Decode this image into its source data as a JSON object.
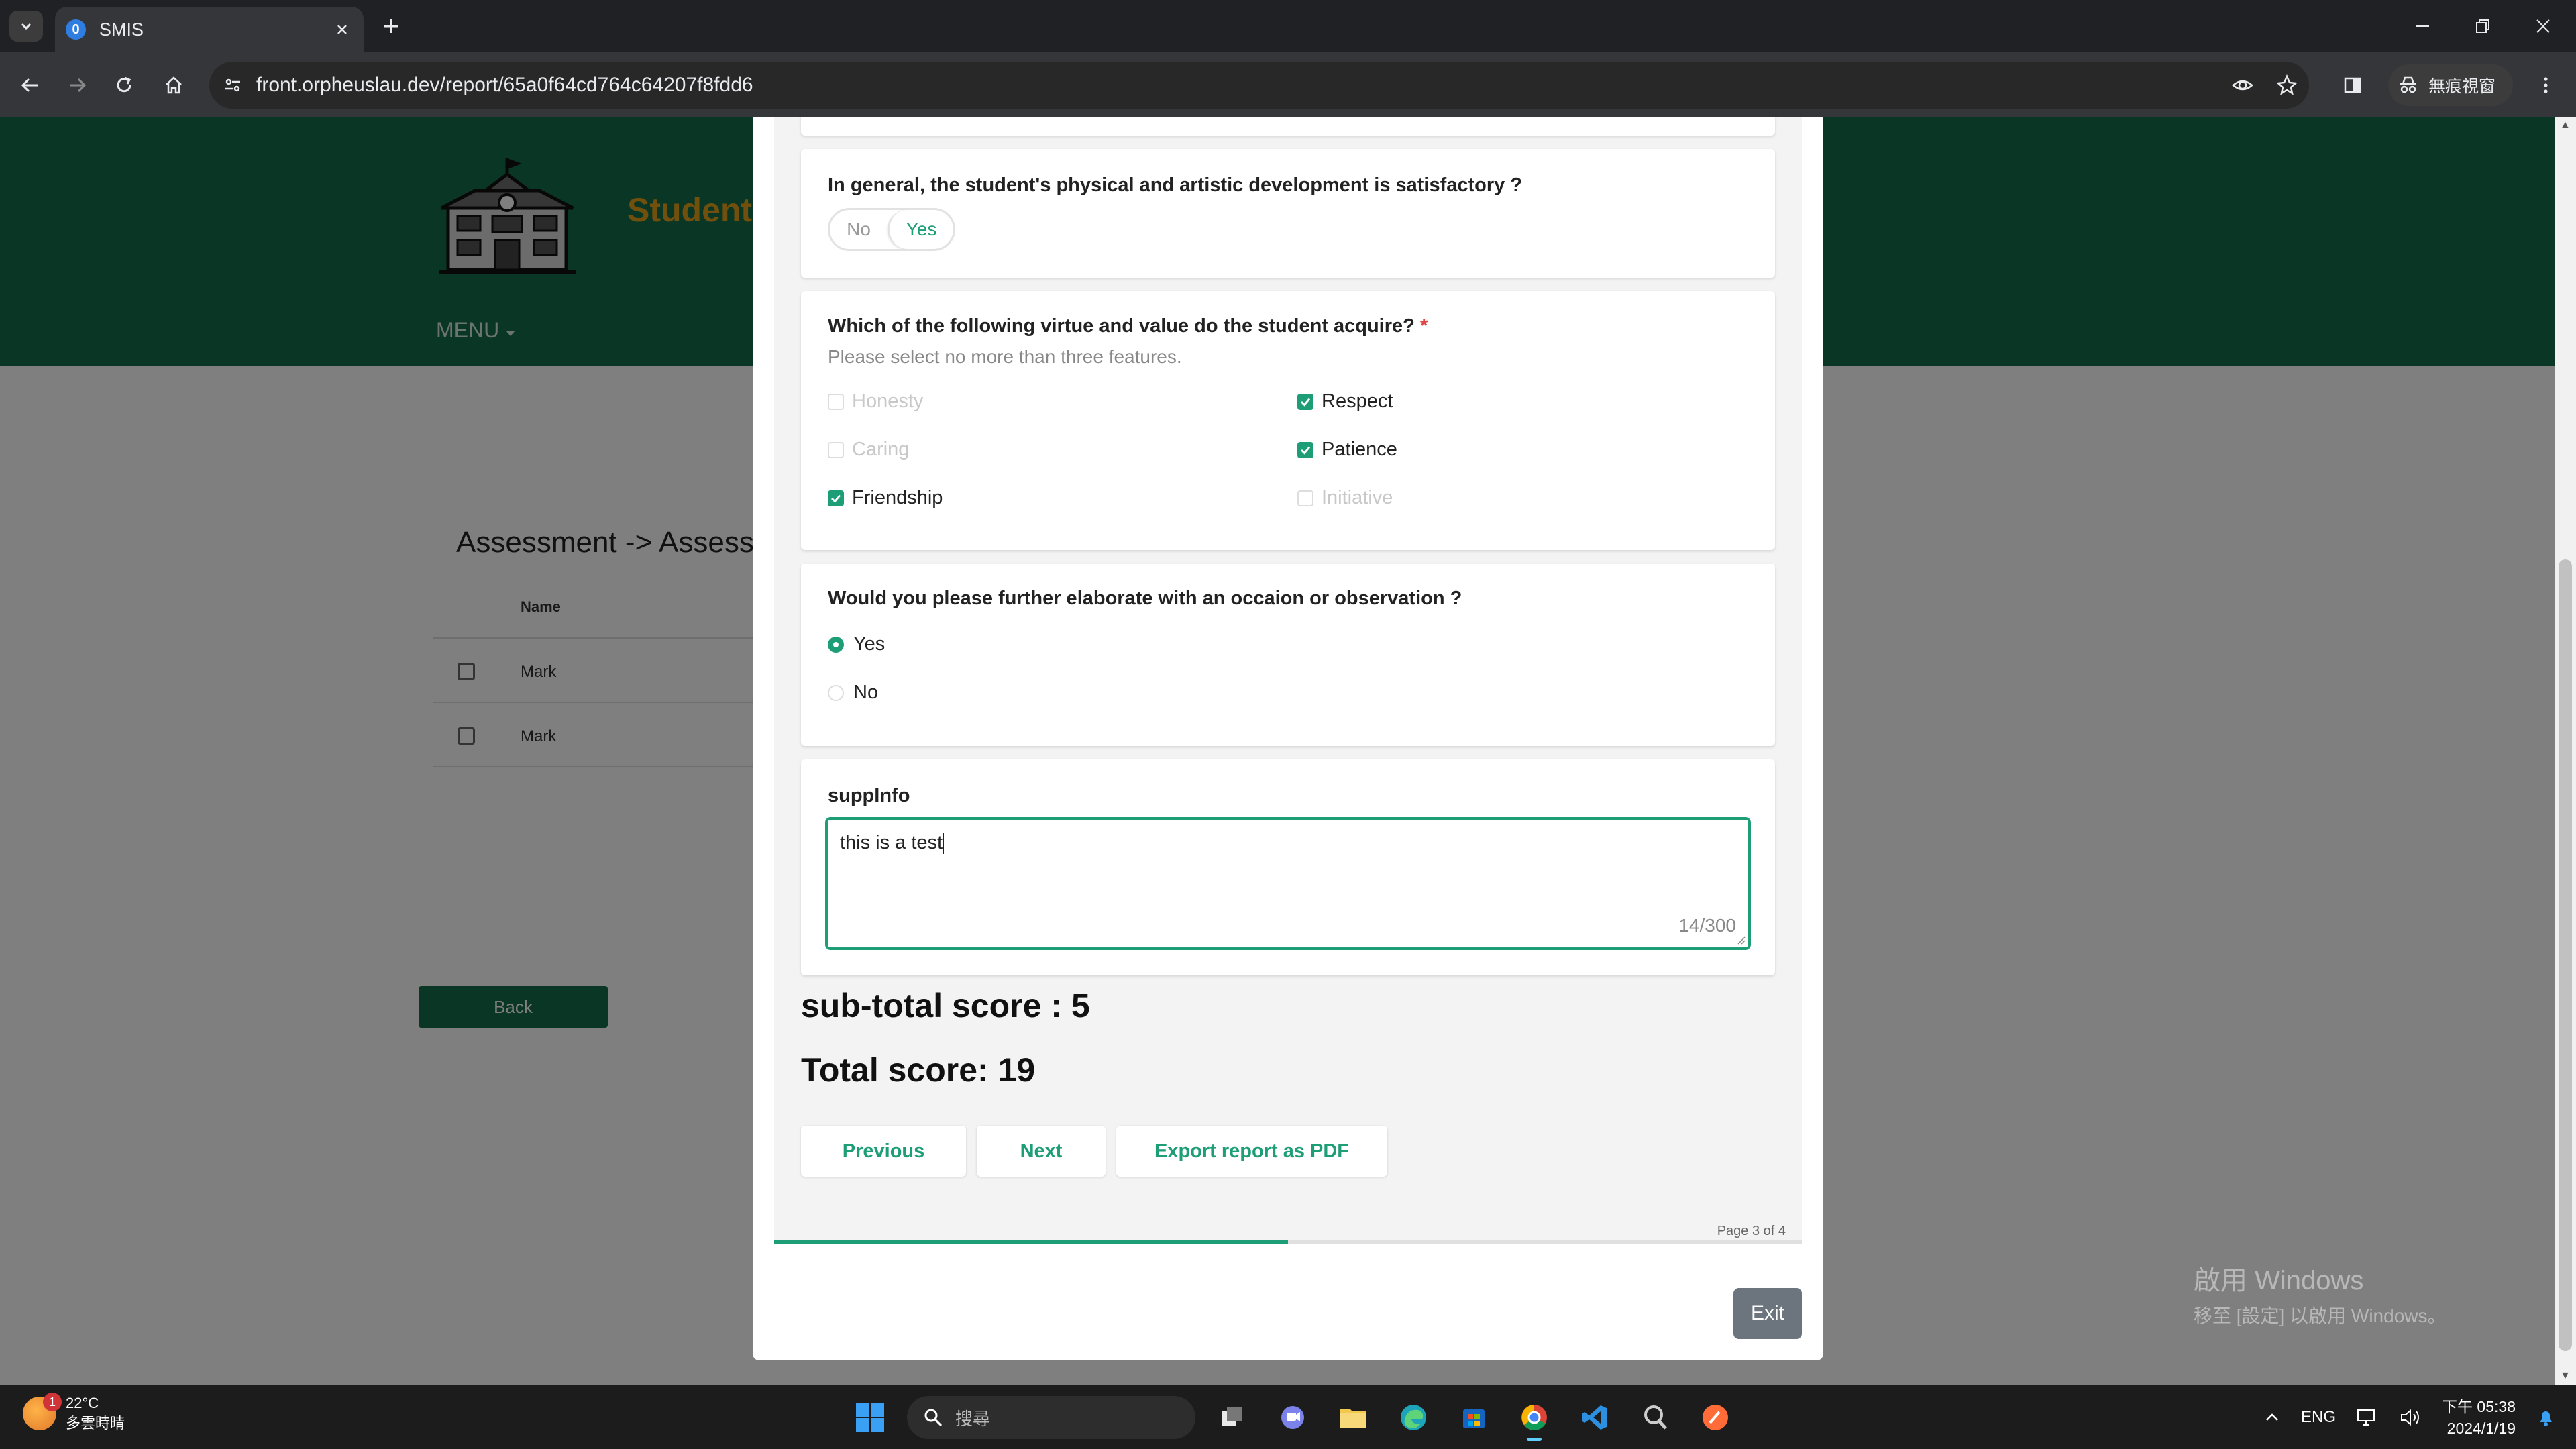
{
  "browser": {
    "tab_title": "SMIS",
    "url": "front.orpheuslau.dev/report/65a0f64cd764c64207f8fdd6",
    "profile_label": "無痕視窗"
  },
  "site": {
    "title": "Student",
    "menu_label": "MENU",
    "breadcrumb": "Assessment -> Assessm",
    "table": {
      "header_name": "Name",
      "rows": [
        "Mark",
        "Mark"
      ]
    },
    "back_label": "Back"
  },
  "form": {
    "q_physical": {
      "title": "In general, the student's physical and artistic development is satisfactory ?",
      "options": [
        "No",
        "Yes"
      ],
      "selected": "Yes"
    },
    "q_virtue": {
      "title": "Which of the following virtue and value do the student acquire?",
      "required_mark": "*",
      "description": "Please select no more than three features.",
      "options": [
        {
          "label": "Honesty",
          "checked": false
        },
        {
          "label": "Respect",
          "checked": true
        },
        {
          "label": "Caring",
          "checked": false
        },
        {
          "label": "Patience",
          "checked": true
        },
        {
          "label": "Friendship",
          "checked": true
        },
        {
          "label": "Initiative",
          "checked": false
        }
      ]
    },
    "q_elaborate": {
      "title": "Would you please further elaborate with an occaion or observation ?",
      "options": [
        "Yes",
        "No"
      ],
      "selected": "Yes"
    },
    "supp_info": {
      "label": "suppInfo",
      "value": "this is a test",
      "counter": "14/300"
    },
    "subtotal": "sub-total score : 5",
    "total": "Total score: 19",
    "buttons": {
      "previous": "Previous",
      "next": "Next",
      "export": "Export report as PDF"
    },
    "page_indicator": "Page 3 of 4",
    "progress_fraction": 0.5,
    "exit_label": "Exit"
  },
  "windows": {
    "watermark_title": "啟用 Windows",
    "watermark_sub": "移至 [設定] 以啟用 Windows。",
    "weather_temp": "22°C",
    "weather_desc": "多雲時晴",
    "weather_badge": "1",
    "search_placeholder": "搜尋",
    "lang": "ENG",
    "time": "下午 05:38",
    "date": "2024/1/19"
  },
  "colors": {
    "brand_green": "#146c4a",
    "accent_teal": "#1e9e76",
    "title_gold": "#e0a019"
  }
}
